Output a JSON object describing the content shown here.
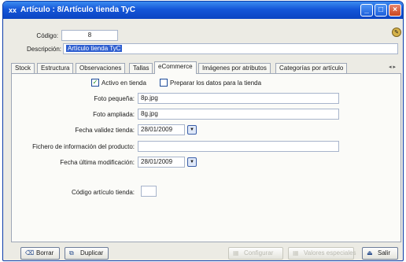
{
  "window": {
    "title": "Artículo : 8/Artículo tienda TyC",
    "app_icon": "xx",
    "minimize": "_",
    "maximize": "□",
    "close": "×"
  },
  "header": {
    "codigo_label": "Código:",
    "codigo_value": "8",
    "descripcion_label": "Descripción:",
    "descripcion_value": "Artículo tienda TyC"
  },
  "tabs": [
    {
      "label": "Stock"
    },
    {
      "label": "Estructura"
    },
    {
      "label": "Observaciones"
    },
    {
      "label": "Tallas"
    },
    {
      "label": "eCommerce"
    },
    {
      "label": "Imágenes por atributos"
    },
    {
      "label": "Categorías por artículo"
    }
  ],
  "tab_scroll": "◂ ▸",
  "ecommerce": {
    "activo_label": "Activo en tienda",
    "activo_checked": true,
    "preparar_label": "Preparar los datos para la tienda",
    "preparar_checked": false,
    "foto_pequena_label": "Foto pequeña:",
    "foto_pequena_value": "8p.jpg",
    "foto_ampliada_label": "Foto ampliada:",
    "foto_ampliada_value": "8g.jpg",
    "fecha_validez_label": "Fecha validez tienda:",
    "fecha_validez_value": "28/01/2009",
    "fichero_label": "Fichero de información del producto:",
    "fichero_value": "",
    "fecha_modif_label": "Fecha última modificación:",
    "fecha_modif_value": "28/01/2009",
    "codigo_tienda_label": "Código artículo tienda:",
    "codigo_tienda_value": ""
  },
  "buttons": {
    "borrar": "Borrar",
    "duplicar": "Duplicar",
    "disabled_1": "Configurar",
    "disabled_2": "Valores especiales",
    "salir": "Salir"
  },
  "colors": {
    "titlebar": "#1456d8",
    "selection": "#2f5fd0",
    "panel": "#fbfbf8"
  }
}
